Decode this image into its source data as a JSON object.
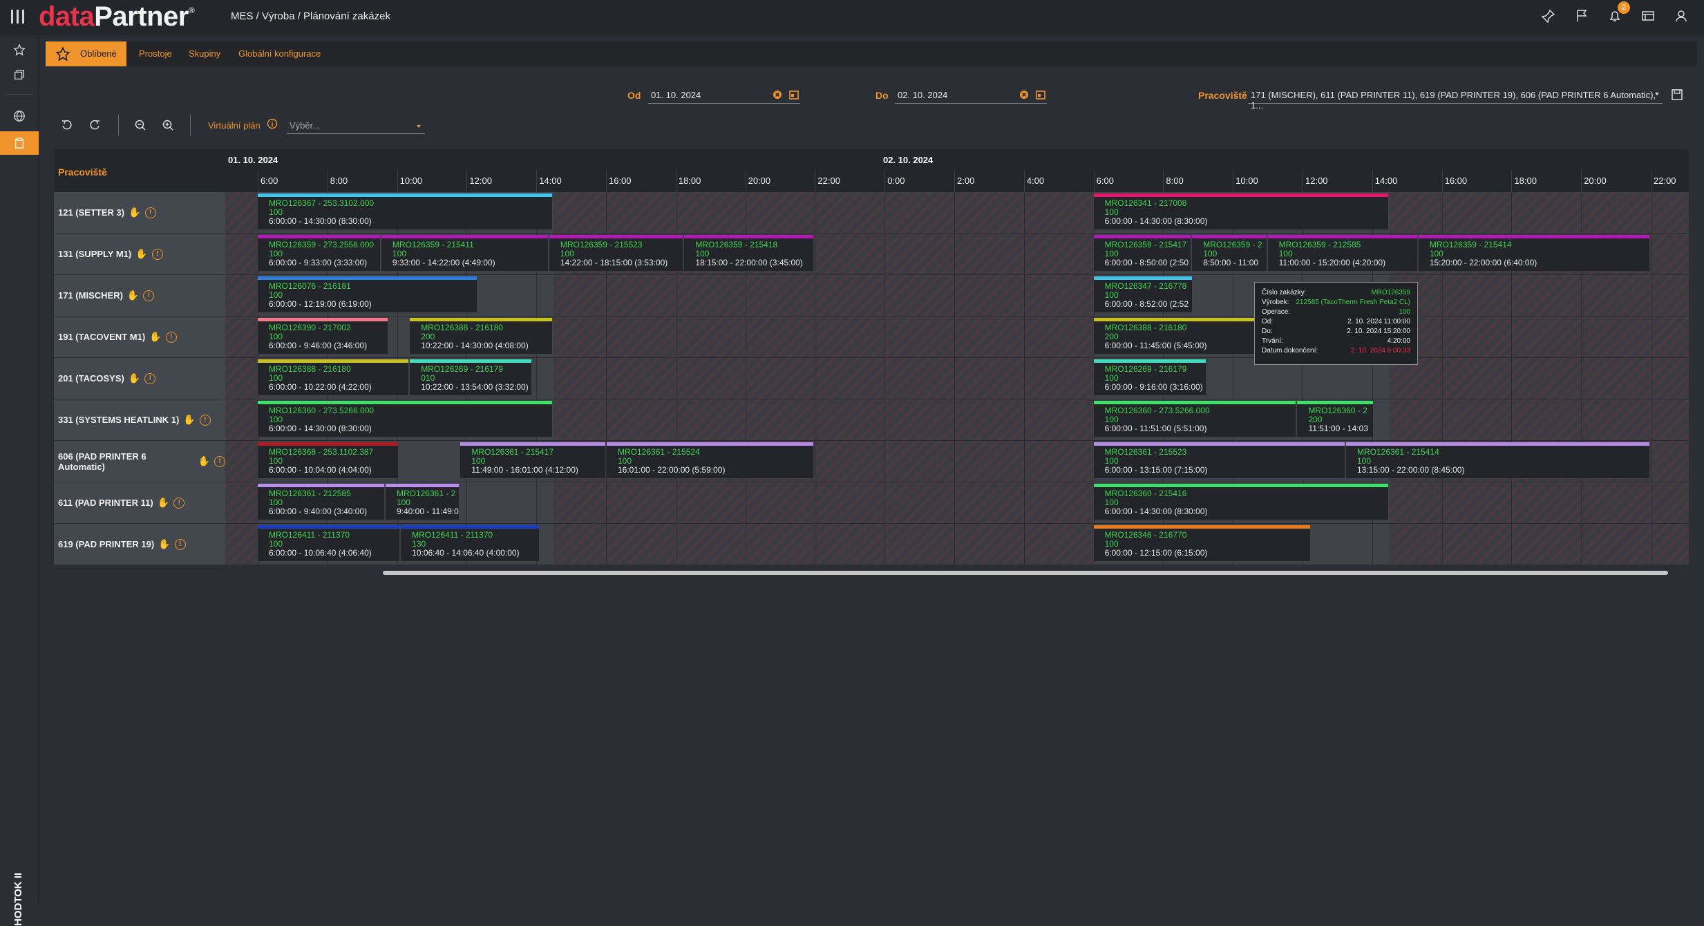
{
  "app": {
    "logo_part1": "data",
    "logo_part2": "Partner",
    "logo_reg": "®",
    "breadcrumb": "MES / Výroba / Plánování zakázek",
    "notif_count": "2"
  },
  "sidebar": {
    "vertical_label": "HODTOK II"
  },
  "tabs": [
    {
      "label": "Oblíbené"
    },
    {
      "label": "Prostoje"
    },
    {
      "label": "Skupiny"
    },
    {
      "label": "Globální konfigurace"
    }
  ],
  "filters": {
    "from_label": "Od",
    "from_value": "01. 10. 2024",
    "to_label": "Do",
    "to_value": "02. 10. 2024",
    "workplace_label": "Pracoviště",
    "workplace_value": "171 (MISCHER), 611 (PAD PRINTER 11), 619 (PAD PRINTER 19), 606 (PAD PRINTER 6 Automatic), 1..."
  },
  "toolbar": {
    "virtual_plan_label": "Virtuální plán",
    "virtual_plan_placeholder": "Výběr..."
  },
  "gantt": {
    "column_header": "Pracoviště",
    "day1": "01. 10. 2024",
    "day2": "02. 10. 2024",
    "hours_day1": [
      "6:00",
      "8:00",
      "10:00",
      "12:00",
      "14:00",
      "16:00",
      "18:00",
      "20:00",
      "22:00"
    ],
    "hours_day2": [
      "0:00",
      "2:00",
      "4:00",
      "6:00",
      "8:00",
      "10:00",
      "12:00",
      "14:00",
      "16:00",
      "18:00",
      "20:00",
      "22:00"
    ],
    "rows": [
      {
        "label": "121 (SETTER 3)",
        "tasks": [
          {
            "color": "#3ec6f0",
            "start": 6,
            "end": 14.5,
            "title": "MRO126367 - 253.3102.000",
            "qty": "100",
            "time": "6:00:00 - 14:30:00 (8:30:00)"
          },
          {
            "color": "#e8146e",
            "start": 30,
            "end": 38.5,
            "title": "MRO126341 - 217008",
            "qty": "100",
            "time": "6:00:00 - 14:30:00 (8:30:00)"
          }
        ]
      },
      {
        "label": "131 (SUPPLY M1)",
        "tasks": [
          {
            "color": "#b21ab5",
            "start": 6,
            "end": 9.55,
            "title": "MRO126359 - 273.2556.000",
            "qty": "100",
            "time": "6:00:00 - 9:33:00 (3:33:00)"
          },
          {
            "color": "#b21ab5",
            "start": 9.55,
            "end": 14.37,
            "title": "MRO126359 - 215411",
            "qty": "100",
            "time": "9:33:00 - 14:22:00 (4:49:00)"
          },
          {
            "color": "#b21ab5",
            "start": 14.37,
            "end": 18.25,
            "title": "MRO126359 - 215523",
            "qty": "100",
            "time": "14:22:00 - 18:15:00 (3:53:00)"
          },
          {
            "color": "#b21ab5",
            "start": 18.25,
            "end": 22,
            "title": "MRO126359 - 215418",
            "qty": "100",
            "time": "18:15:00 - 22:00:00 (3:45:00)"
          },
          {
            "color": "#b21ab5",
            "start": 30,
            "end": 32.83,
            "title": "MRO126359 - 215417",
            "qty": "100",
            "time": "6:00:00 - 8:50:00 (2:50"
          },
          {
            "color": "#b21ab5",
            "start": 32.83,
            "end": 35,
            "title": "MRO126359 - 2",
            "qty": "100",
            "time": "8:50:00 - 11:00"
          },
          {
            "color": "#b21ab5",
            "start": 35,
            "end": 39.33,
            "title": "MRO126359 - 212585",
            "qty": "100",
            "time": "11:00:00 - 15:20:00 (4:20:00)"
          },
          {
            "color": "#b21ab5",
            "start": 39.33,
            "end": 46,
            "title": "MRO126359 - 215414",
            "qty": "100",
            "time": "15:20:00 - 22:00:00 (6:40:00)"
          }
        ]
      },
      {
        "label": "171 (MISCHER)",
        "tasks": [
          {
            "color": "#2a7fe0",
            "start": 6,
            "end": 12.32,
            "title": "MRO126076 - 216181",
            "qty": "100",
            "time": "6:00:00 - 12:19:00 (6:19:00)"
          },
          {
            "color": "#3ec6f0",
            "start": 30,
            "end": 32.87,
            "title": "MRO126347 - 216778",
            "qty": "100",
            "time": "6:00:00 - 8:52:00 (2:52"
          }
        ]
      },
      {
        "label": "191 (TACOVENT M1)",
        "tasks": [
          {
            "color": "#f07a8a",
            "start": 6,
            "end": 9.77,
            "title": "MRO126390 - 217002",
            "qty": "100",
            "time": "6:00:00 - 9:46:00 (3:46:00)"
          },
          {
            "color": "#c8c21a",
            "start": 10.37,
            "end": 14.5,
            "title": "MRO126388 - 216180",
            "qty": "200",
            "time": "10:22:00 - 14:30:00 (4:08:00)"
          },
          {
            "color": "#c8c21a",
            "start": 30,
            "end": 34.8,
            "title": "MRO126388 - 216180",
            "qty": "200",
            "time": "6:00:00 - 11:45:00 (5:45:00)"
          }
        ]
      },
      {
        "label": "201 (TACOSYS)",
        "tasks": [
          {
            "color": "#c8c21a",
            "start": 6,
            "end": 10.37,
            "title": "MRO126388 - 216180",
            "qty": "100",
            "time": "6:00:00 - 10:22:00 (4:22:00)"
          },
          {
            "color": "#3ee0c0",
            "start": 10.37,
            "end": 13.9,
            "title": "MRO126269 - 216179",
            "qty": "010",
            "time": "10:22:00 - 13:54:00 (3:32:00)"
          },
          {
            "color": "#3ee0c0",
            "start": 30,
            "end": 33.27,
            "title": "MRO126269 - 216179",
            "qty": "100",
            "time": "6:00:00 - 9:16:00 (3:16:00)"
          }
        ]
      },
      {
        "label": "331 (SYSTEMS HEATLINK 1)",
        "tasks": [
          {
            "color": "#3ee06a",
            "start": 6,
            "end": 14.5,
            "title": "MRO126360 - 273.5266.000",
            "qty": "100",
            "time": "6:00:00 - 14:30:00 (8:30:00)"
          },
          {
            "color": "#3ee06a",
            "start": 30,
            "end": 35.85,
            "title": "MRO126360 - 273.5266.000",
            "qty": "100",
            "time": "6:00:00 - 11:51:00 (5:51:00)"
          },
          {
            "color": "#3ee06a",
            "start": 35.85,
            "end": 38.07,
            "title": "MRO126360 - 2",
            "qty": "200",
            "time": "11:51:00 - 14:03"
          }
        ]
      },
      {
        "label": "606 (PAD PRINTER 6 Automatic)",
        "tasks": [
          {
            "color": "#b01a20",
            "start": 6,
            "end": 10.07,
            "title": "MRO126368 - 253.1102.387",
            "qty": "100",
            "time": "6:00:00 - 10:04:00 (4:04:00)"
          },
          {
            "color": "#b98ee8",
            "start": 11.82,
            "end": 16.02,
            "title": "MRO126361 - 215417",
            "qty": "100",
            "time": "11:49:00 - 16:01:00 (4:12:00)"
          },
          {
            "color": "#b98ee8",
            "start": 16.02,
            "end": 22,
            "title": "MRO126361 - 215524",
            "qty": "100",
            "time": "16:01:00 - 22:00:00 (5:59:00)"
          },
          {
            "color": "#b98ee8",
            "start": 30,
            "end": 37.25,
            "title": "MRO126361 - 215523",
            "qty": "100",
            "time": "6:00:00 - 13:15:00 (7:15:00)"
          },
          {
            "color": "#b98ee8",
            "start": 37.25,
            "end": 46,
            "title": "MRO126361 - 215414",
            "qty": "100",
            "time": "13:15:00 - 22:00:00 (8:45:00)"
          }
        ]
      },
      {
        "label": "611 (PAD PRINTER 11)",
        "tasks": [
          {
            "color": "#b98ee8",
            "start": 6,
            "end": 9.67,
            "title": "MRO126361 - 212585",
            "qty": "100",
            "time": "6:00:00 - 9:40:00 (3:40:00)"
          },
          {
            "color": "#b98ee8",
            "start": 9.67,
            "end": 11.82,
            "title": "MRO126361 - 2",
            "qty": "100",
            "time": "9:40:00 - 11:49:0"
          },
          {
            "color": "#3ee06a",
            "start": 30,
            "end": 38.5,
            "title": "MRO126360 - 215416",
            "qty": "100",
            "time": "6:00:00 - 14:30:00 (8:30:00)"
          }
        ]
      },
      {
        "label": "619 (PAD PRINTER 19)",
        "tasks": [
          {
            "color": "#1a3ec0",
            "start": 6,
            "end": 10.11,
            "title": "MRO126411 - 211370",
            "qty": "100",
            "time": "6:00:00 - 10:06:40 (4:06:40)"
          },
          {
            "color": "#1a3ec0",
            "start": 10.11,
            "end": 14.11,
            "title": "MRO126411 - 211370",
            "qty": "130",
            "time": "10:06:40 - 14:06:40 (4:00:00)"
          },
          {
            "color": "#e87a1a",
            "start": 30,
            "end": 36.25,
            "title": "MRO126346 - 216770",
            "qty": "100",
            "time": "6:00:00 - 12:15:00 (6:15:00)"
          }
        ]
      }
    ]
  },
  "tooltip": {
    "rows": [
      {
        "k": "Číslo zakázky:",
        "v": "MRO126359"
      },
      {
        "k": "Výrobek:",
        "v": "212585 (TacoTherm Fresh Peta2 CL)"
      },
      {
        "k": "Operace:",
        "v": "100"
      },
      {
        "k": "Od:",
        "v": "2. 10. 2024 11:00:00"
      },
      {
        "k": "Do:",
        "v": "2. 10. 2024 15:20:00"
      },
      {
        "k": "Trvání:",
        "v": "4:20:00"
      },
      {
        "k": "Datum dokončení:",
        "v": "2. 10. 2024 6:00:33"
      }
    ]
  },
  "icons": [
    "menu-icon",
    "pin-icon",
    "flag-icon",
    "bell-icon",
    "table-icon",
    "user-icon",
    "star-icon",
    "layers-icon",
    "globe-icon",
    "clipboard-icon",
    "undo-icon",
    "redo-icon",
    "zoom-out-icon",
    "zoom-in-icon",
    "info-icon",
    "clear-icon",
    "calendar-icon",
    "save-icon",
    "hand-icon",
    "alert-icon"
  ]
}
